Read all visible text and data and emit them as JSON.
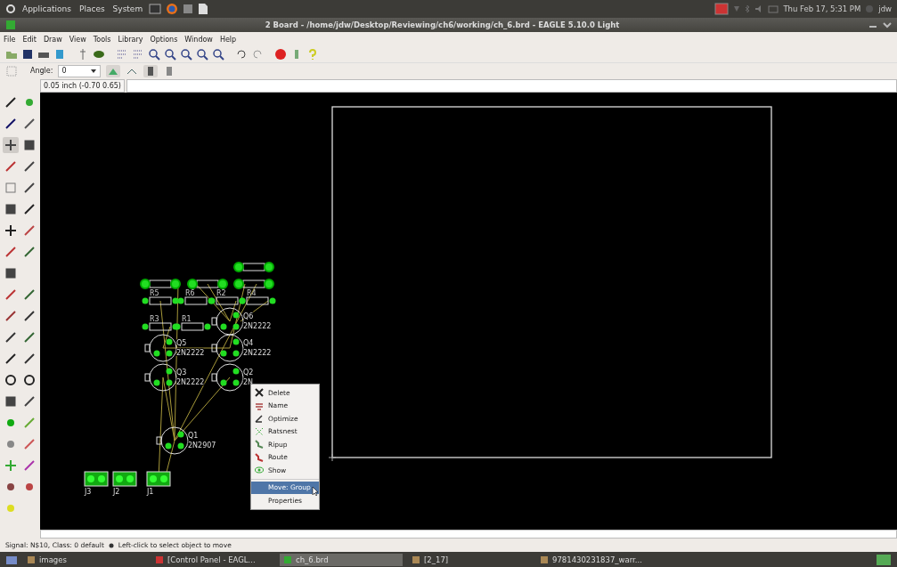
{
  "top_panel": {
    "menus": [
      "Applications",
      "Places",
      "System"
    ],
    "clock": "Thu Feb 17, 5:31 PM",
    "user": "jdw"
  },
  "window": {
    "title": "2 Board - /home/jdw/Desktop/Reviewing/ch6/working/ch_6.brd - EAGLE 5.10.0 Light"
  },
  "menubar": [
    "File",
    "Edit",
    "Draw",
    "View",
    "Tools",
    "Library",
    "Options",
    "Window",
    "Help"
  ],
  "parameters": {
    "angle_label": "Angle:",
    "angle_value": "0"
  },
  "coordinates": "0.05 inch (-0.70 0.65)",
  "board": {
    "resistors": [
      {
        "kind": "large"
      },
      {
        "kind": "large"
      },
      {
        "kind": "large"
      },
      {
        "kind": "large"
      },
      {
        "kind": "small",
        "label": "R5"
      },
      {
        "kind": "small",
        "label": "R6"
      },
      {
        "kind": "small",
        "label": "R2"
      },
      {
        "kind": "small",
        "label": "R4"
      },
      {
        "kind": "small",
        "label": "R3"
      },
      {
        "kind": "small",
        "label": "R1"
      }
    ],
    "transistors": [
      {
        "name": "Q6",
        "value": "2N2222"
      },
      {
        "name": "Q5",
        "value": "2N2222"
      },
      {
        "name": "Q4",
        "value": "2N2222"
      },
      {
        "name": "Q3",
        "value": "2N2222"
      },
      {
        "name": "Q2",
        "value": "2N"
      },
      {
        "name": "Q1",
        "value": "2N2907"
      }
    ],
    "connectors": [
      {
        "name": "J3"
      },
      {
        "name": "J2"
      },
      {
        "name": "J1"
      }
    ]
  },
  "context_menu": {
    "items": [
      {
        "label": "Delete",
        "kind": "delete",
        "selected": false
      },
      {
        "label": "Name",
        "kind": "name",
        "selected": false
      },
      {
        "label": "Optimize",
        "kind": "optimize",
        "selected": false
      },
      {
        "label": "Ratsnest",
        "kind": "ratsnest",
        "selected": false
      },
      {
        "label": "Ripup",
        "kind": "ripup",
        "selected": false
      },
      {
        "label": "Route",
        "kind": "route",
        "selected": false
      },
      {
        "label": "Show",
        "kind": "show",
        "selected": false
      },
      {
        "label": "Move: Group",
        "kind": "plain",
        "selected": true
      },
      {
        "label": "Properties",
        "kind": "plain",
        "selected": false
      }
    ]
  },
  "status_bar": {
    "signal": "Signal: N$10, Class: 0 default",
    "hint": "Left-click to select object to move"
  },
  "taskbar": {
    "items": [
      {
        "label": "images",
        "selected": false
      },
      {
        "label": "[Control Panel - EAGL...",
        "selected": false
      },
      {
        "label": "ch_6.brd",
        "selected": true
      },
      {
        "label": "[2_17]",
        "selected": false
      },
      {
        "label": "9781430231837_warr...",
        "selected": false
      }
    ]
  }
}
